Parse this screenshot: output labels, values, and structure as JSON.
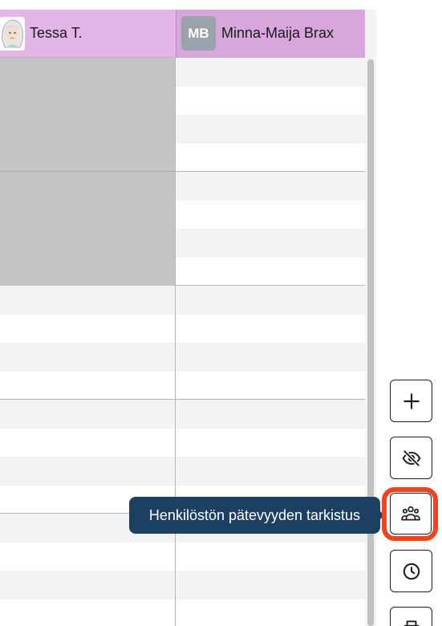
{
  "columns": [
    {
      "name": "Tessa T.",
      "avatar": "image"
    },
    {
      "name": "Minna-Maija Brax",
      "initials": "MB"
    }
  ],
  "toolbar": {
    "add_icon": "plus-icon",
    "hide_icon": "eye-off-icon",
    "staff_icon": "users-group-icon",
    "clock_icon": "clock-icon",
    "print_icon": "printer-icon"
  },
  "tooltip": {
    "text": "Henkilöstön pätevyyden tarkistus"
  },
  "colors": {
    "tessa_header": "#e4b6e8",
    "minna_header": "#d8a6dd",
    "tooltip_bg": "#1c4061",
    "highlight": "#f0441f",
    "busy_block": "#c4c4c4"
  }
}
